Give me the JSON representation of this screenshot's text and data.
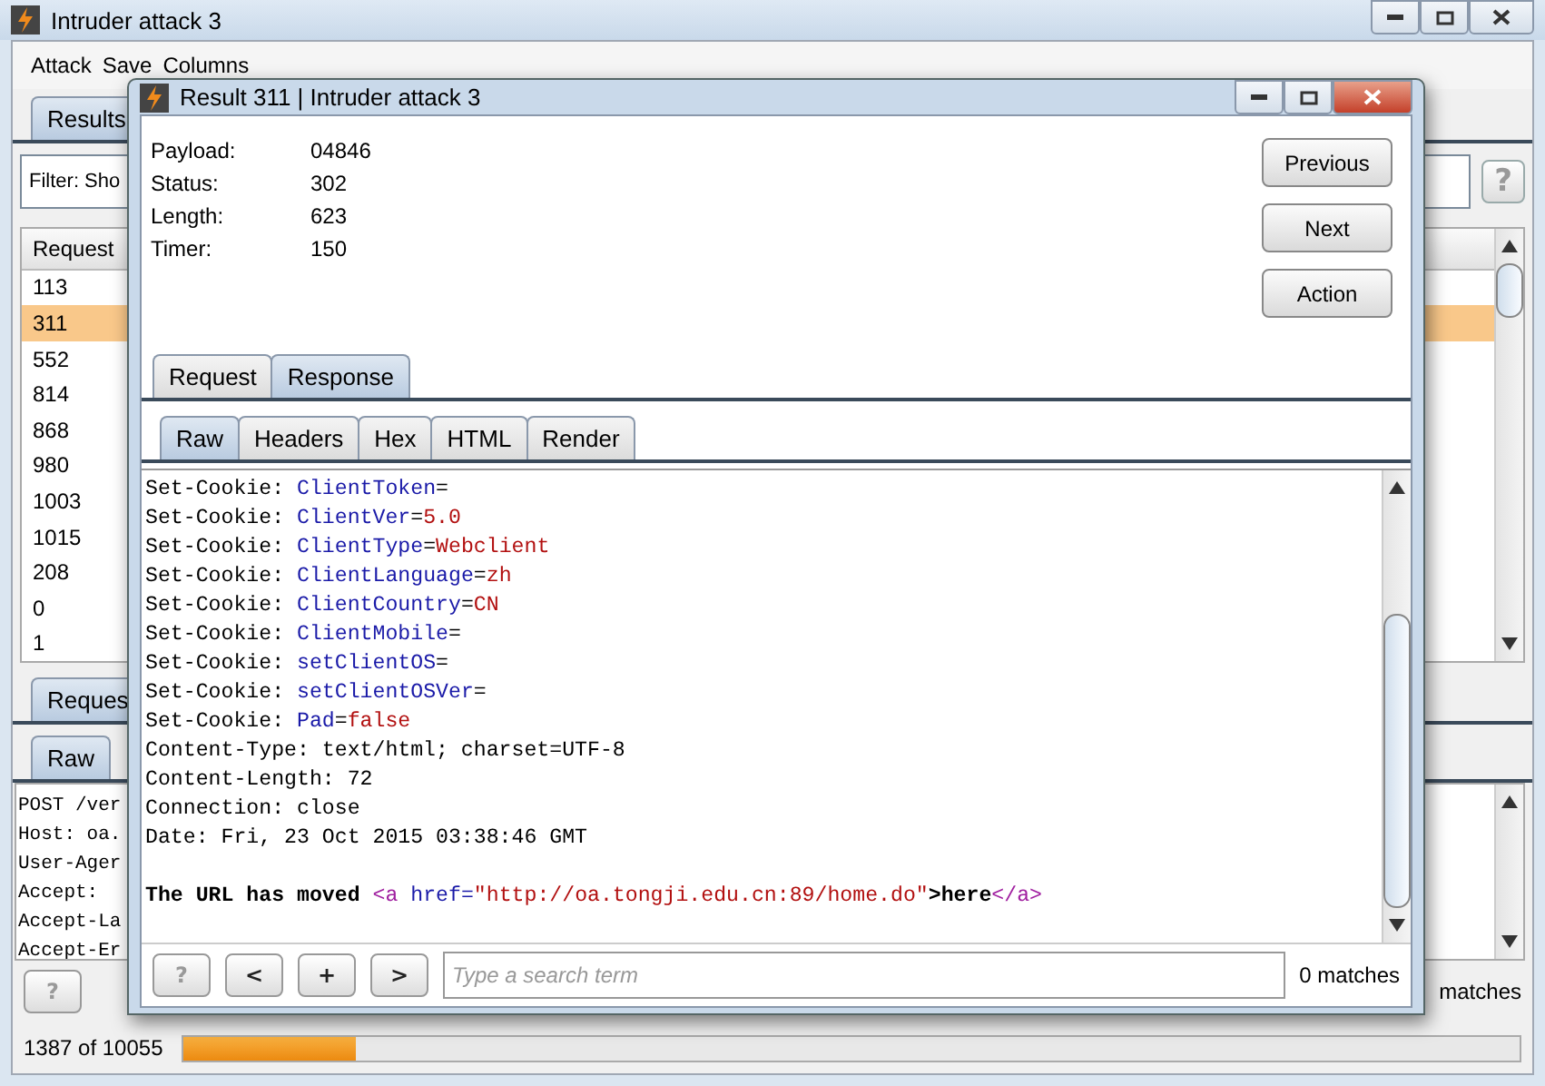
{
  "main_window": {
    "title": "Intruder attack 3",
    "menu": [
      "Attack",
      "Save",
      "Columns"
    ],
    "tabs": [
      {
        "label": "Results",
        "selected": true
      }
    ],
    "filter": {
      "label": "Filter: Sho"
    },
    "help_button": "?",
    "table": {
      "columns": [
        "Request"
      ],
      "rows": [
        {
          "request": "113",
          "selected": false
        },
        {
          "request": "311",
          "selected": true
        },
        {
          "request": "552",
          "selected": false
        },
        {
          "request": "814",
          "selected": false
        },
        {
          "request": "868",
          "selected": false
        },
        {
          "request": "980",
          "selected": false
        },
        {
          "request": "1003",
          "selected": false
        },
        {
          "request": "1015",
          "selected": false
        },
        {
          "request": "208",
          "selected": false
        },
        {
          "request": "0",
          "selected": false
        },
        {
          "request": "1",
          "selected": false
        }
      ]
    },
    "detail_tabs": [
      {
        "label": "Reques",
        "selected": true
      }
    ],
    "detail_subtabs": [
      {
        "label": "Raw",
        "selected": true
      }
    ],
    "request_lines": [
      "POST /ver",
      "Host: oa.",
      "User-Ager",
      "Accept:",
      "Accept-La",
      "Accept-Er"
    ],
    "search_help": "?",
    "matches": "matches",
    "status": {
      "text": "1387 of 10055",
      "level": 0.13
    }
  },
  "dialog": {
    "title": "Result 311 | Intruder attack 3",
    "fields": [
      {
        "label": "Payload:",
        "value": "04846"
      },
      {
        "label": "Status:",
        "value": "302"
      },
      {
        "label": "Length:",
        "value": "623"
      },
      {
        "label": "Timer:",
        "value": "150"
      }
    ],
    "buttons": [
      "Previous",
      "Next",
      "Action"
    ],
    "tabs": [
      {
        "label": "Request",
        "selected": false
      },
      {
        "label": "Response",
        "selected": true
      }
    ],
    "subtabs": [
      {
        "label": "Raw",
        "selected": true
      },
      {
        "label": "Headers",
        "selected": false
      },
      {
        "label": "Hex",
        "selected": false
      },
      {
        "label": "HTML",
        "selected": false
      },
      {
        "label": "Render",
        "selected": false
      }
    ],
    "lines": [
      [
        {
          "kind": "plain",
          "text": "Set-Cookie: "
        },
        {
          "kind": "name",
          "text": "ClientToken"
        },
        {
          "kind": "plain",
          "text": "="
        }
      ],
      [
        {
          "kind": "plain",
          "text": "Set-Cookie: "
        },
        {
          "kind": "name",
          "text": "ClientVer"
        },
        {
          "kind": "plain",
          "text": "="
        },
        {
          "kind": "value",
          "text": "5.0"
        }
      ],
      [
        {
          "kind": "plain",
          "text": "Set-Cookie: "
        },
        {
          "kind": "name",
          "text": "ClientType"
        },
        {
          "kind": "plain",
          "text": "="
        },
        {
          "kind": "value",
          "text": "Webclient"
        }
      ],
      [
        {
          "kind": "plain",
          "text": "Set-Cookie: "
        },
        {
          "kind": "name",
          "text": "ClientLanguage"
        },
        {
          "kind": "plain",
          "text": "="
        },
        {
          "kind": "value",
          "text": "zh"
        }
      ],
      [
        {
          "kind": "plain",
          "text": "Set-Cookie: "
        },
        {
          "kind": "name",
          "text": "ClientCountry"
        },
        {
          "kind": "plain",
          "text": "="
        },
        {
          "kind": "value",
          "text": "CN"
        }
      ],
      [
        {
          "kind": "plain",
          "text": "Set-Cookie: "
        },
        {
          "kind": "name",
          "text": "ClientMobile"
        },
        {
          "kind": "plain",
          "text": "="
        }
      ],
      [
        {
          "kind": "plain",
          "text": "Set-Cookie: "
        },
        {
          "kind": "name",
          "text": "setClientOS"
        },
        {
          "kind": "plain",
          "text": "="
        }
      ],
      [
        {
          "kind": "plain",
          "text": "Set-Cookie: "
        },
        {
          "kind": "name",
          "text": "setClientOSVer"
        },
        {
          "kind": "plain",
          "text": "="
        }
      ],
      [
        {
          "kind": "plain",
          "text": "Set-Cookie: "
        },
        {
          "kind": "name",
          "text": "Pad"
        },
        {
          "kind": "plain",
          "text": "="
        },
        {
          "kind": "value",
          "text": "false"
        }
      ],
      [
        {
          "kind": "plain",
          "text": "Content-Type: text/html; charset=UTF-8"
        }
      ],
      [
        {
          "kind": "plain",
          "text": "Content-Length: 72"
        }
      ],
      [
        {
          "kind": "plain",
          "text": "Connection: close"
        }
      ],
      [
        {
          "kind": "plain",
          "text": "Date: Fri, 23 Oct 2015 03:38:46 GMT"
        }
      ]
    ],
    "body": [
      {
        "kind": "bold",
        "text": "The URL has moved "
      },
      {
        "kind": "tag",
        "text": "<a"
      },
      {
        "kind": "name",
        "text": " href="
      },
      {
        "kind": "value",
        "text": "\"http://oa.tongji.edu.cn:89/home.do\""
      },
      {
        "kind": "bold",
        "text": ">here"
      },
      {
        "kind": "tag",
        "text": "</a>"
      }
    ],
    "search": {
      "buttons": [
        "?",
        "<",
        "+",
        ">"
      ],
      "placeholder": "Type a search term",
      "matches": "0 matches"
    }
  }
}
